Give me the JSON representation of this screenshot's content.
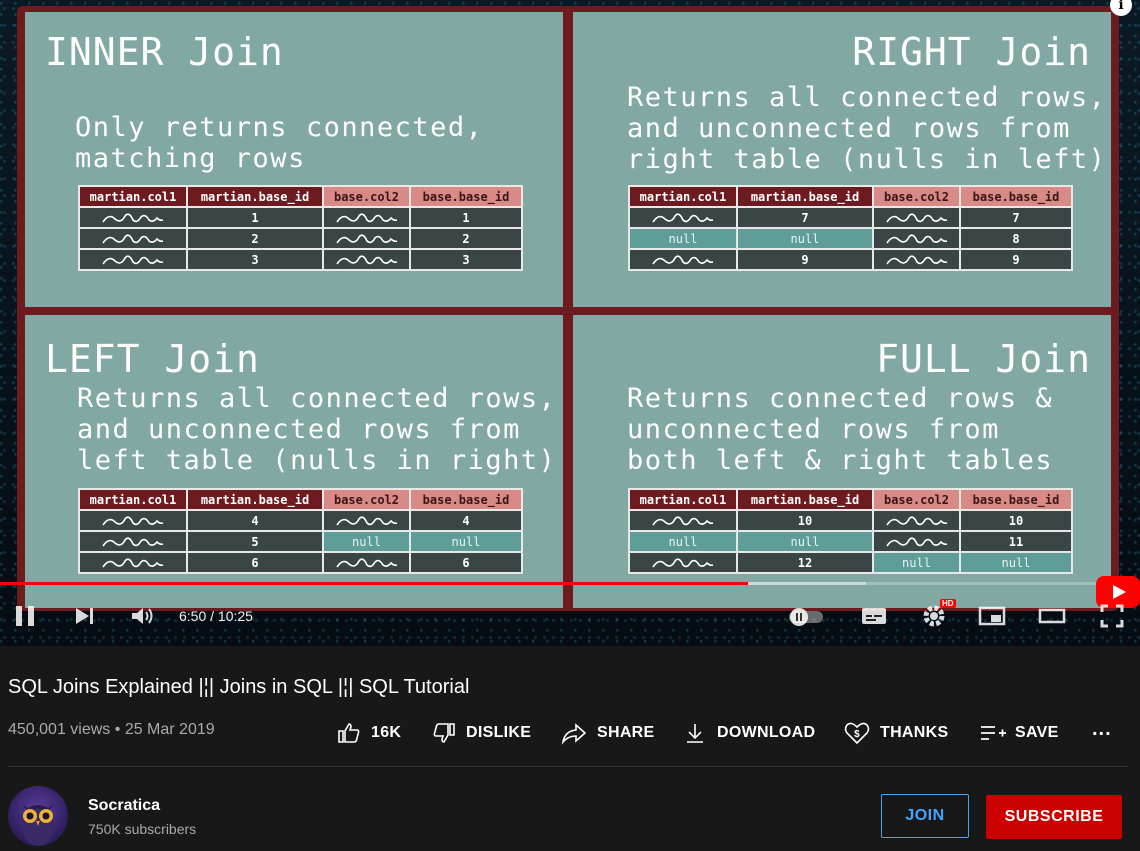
{
  "video": {
    "slide": {
      "quadrants": [
        {
          "title": "INNER Join",
          "description": "Only returns connected,\nmatching rows",
          "headers": [
            "martian.col1",
            "martian.base_id",
            "base.col2",
            "base.base_id"
          ],
          "rows": [
            [
              "~",
              "1",
              "~",
              "1"
            ],
            [
              "~",
              "2",
              "~",
              "2"
            ],
            [
              "~",
              "3",
              "~",
              "3"
            ]
          ]
        },
        {
          "title": "RIGHT Join",
          "description": "Returns all connected rows,\nand unconnected rows from\nright table (nulls in left)",
          "headers": [
            "martian.col1",
            "martian.base_id",
            "base.col2",
            "base.base_id"
          ],
          "rows": [
            [
              "~",
              "7",
              "~",
              "7"
            ],
            [
              "null",
              "null",
              "~",
              "8"
            ],
            [
              "~",
              "9",
              "~",
              "9"
            ]
          ]
        },
        {
          "title": "LEFT Join",
          "description": "Returns all connected rows,\nand unconnected rows from\nleft table (nulls in right)",
          "headers": [
            "martian.col1",
            "martian.base_id",
            "base.col2",
            "base.base_id"
          ],
          "rows": [
            [
              "~",
              "4",
              "~",
              "4"
            ],
            [
              "~",
              "5",
              "null",
              "null"
            ],
            [
              "~",
              "6",
              "~",
              "6"
            ]
          ]
        },
        {
          "title": "FULL Join",
          "description": "Returns connected rows &\nunconnected rows from\nboth left & right tables",
          "headers": [
            "martian.col1",
            "martian.base_id",
            "base.col2",
            "base.base_id"
          ],
          "rows": [
            [
              "~",
              "10",
              "~",
              "10"
            ],
            [
              "null",
              "null",
              "~",
              "11"
            ],
            [
              "~",
              "12",
              "null",
              "null"
            ]
          ]
        }
      ]
    },
    "player": {
      "timecode": "6:50 / 10:25",
      "progress": 0.656,
      "buffered_to": 0.76,
      "quality_badge": "HD",
      "info_label": "i",
      "icons": [
        "pause-icon",
        "next-icon",
        "volume-icon",
        "autoplay-toggle-icon",
        "subtitles-icon",
        "settings-icon",
        "miniplayer-icon",
        "theater-mode-icon",
        "fullscreen-icon"
      ]
    }
  },
  "title": "SQL Joins Explained |¦| Joins in SQL |¦| SQL Tutorial",
  "meta": {
    "views": "450,001 views",
    "separator": "•",
    "date": "25 Mar 2019"
  },
  "actions": {
    "like": "16K",
    "dislike": "DISLIKE",
    "share": "SHARE",
    "download": "DOWNLOAD",
    "thanks": "THANKS",
    "save": "SAVE",
    "more": "..."
  },
  "channel": {
    "name": "Socratica",
    "subscribers": "750K subscribers",
    "join_label": "JOIN",
    "subscribe_label": "SUBSCRIBE"
  },
  "colors": {
    "slide_border": "#6e1b1f",
    "slide_panel": "#82a8a4",
    "header_martian": "#6e1b1f",
    "header_base": "#d88a86",
    "null_cell": "#5f9e98",
    "subscribe": "#cc0000",
    "join": "#3ea6ff",
    "progress": "#ff0000"
  }
}
